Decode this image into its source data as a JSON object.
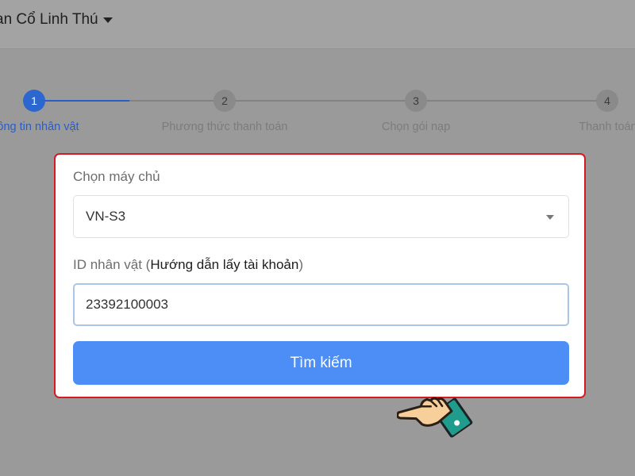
{
  "header": {
    "game_name": "ạn Cổ Linh Thú",
    "dropdown_icon": "caret-down-icon"
  },
  "stepper": {
    "current_step": 1,
    "steps": [
      {
        "number": "1",
        "label": "ông tin nhân vật"
      },
      {
        "number": "2",
        "label": "Phương thức thanh toán"
      },
      {
        "number": "3",
        "label": "Chọn gói nạp"
      },
      {
        "number": "4",
        "label": "Thanh toán"
      }
    ]
  },
  "form": {
    "server_label": "Chọn máy chủ",
    "server_value": "VN-S3",
    "character_id_label": "ID nhân vật (",
    "character_id_guide": "Hướng dẫn lấy tài khoản",
    "character_id_label_end": ")",
    "character_id_value": "23392100003",
    "search_button_label": "Tìm kiếm"
  },
  "colors": {
    "highlight_border": "#d51a22",
    "primary_button": "#4c8df6",
    "active_step": "#2c66cf",
    "overlay": "#9a9a9a"
  },
  "cursor_icon": "pointing-hand-icon"
}
